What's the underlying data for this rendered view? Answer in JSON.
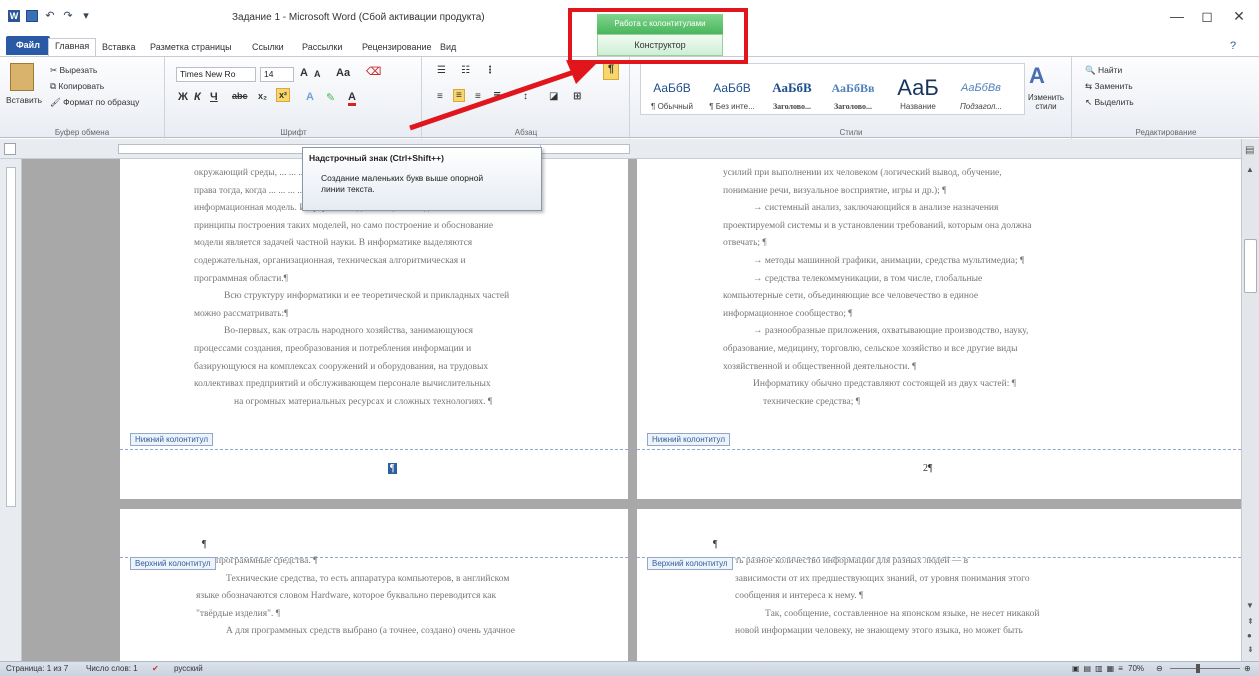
{
  "window": {
    "title": "Задание 1 - Microsoft Word (Сбой активации продукта)",
    "min": "—",
    "max": "◻",
    "close": "✕"
  },
  "tabs": {
    "file": "Файл",
    "items": [
      "Главная",
      "Вставка",
      "Разметка страницы",
      "Ссылки",
      "Рассылки",
      "Рецензирование",
      "Вид"
    ],
    "context_group": "Работа с колонтитулами",
    "context_tab": "Конструктор"
  },
  "ribbon": {
    "clipboard": {
      "paste": "Вставить",
      "cut": "Вырезать",
      "copy": "Копировать",
      "format_painter": "Формат по образцу",
      "label": "Буфер обмена"
    },
    "font": {
      "name": "Times New Ro",
      "size": "14",
      "label": "Шрифт",
      "bold": "Ж",
      "italic": "К",
      "underline": "Ч",
      "grow": "A",
      "shrink": "A",
      "case": "Aa"
    },
    "paragraph": {
      "label": "Абзац",
      "pilcrow": "¶"
    },
    "styles": {
      "label": "Стили",
      "items": [
        {
          "sample": "АаБбВ",
          "name": "¶ Обычный"
        },
        {
          "sample": "АаБбВ",
          "name": "¶ Без инте..."
        },
        {
          "sample": "АаБбВ",
          "name": "Заголово..."
        },
        {
          "sample": "АаБбВв",
          "name": "Заголово..."
        },
        {
          "sample": "АаБ",
          "name": "Название"
        },
        {
          "sample": "АаБбВв",
          "name": "Подзагол..."
        }
      ],
      "change": "Изменить стили"
    },
    "editing": {
      "label": "Редактирование",
      "find": "Найти",
      "replace": "Заменить",
      "select": "Выделить"
    }
  },
  "tooltip": {
    "title": "Надстрочный знак (Ctrl+Shift++)",
    "body": "Создание маленьких букв выше опорной линии текста."
  },
  "pages": {
    "top_left": {
      "lines": [
        "окружающий среды, ... ... ... ... ... ... ... ... ... ... ... ... ... ... ... ... ... ... от в свое",
        "права тогда, когда ... ... ... ... ... ... ... ... ... ... ... ... ... ... ... ... ... ... ... ... ...",
        "информационная модель. Информатика дает общие методологические",
        "принципы построения таких моделей, но само построение и обоснование",
        "модели является задачей частной науки. В информатике выделяются",
        "содержательная, организационная, техническая алгоритмическая и",
        "программная области.¶",
        "Всю структуру информатики и ее теоретической и прикладных частей",
        "можно рассматривать:¶",
        "Во-первых, как отрасль народного хозяйства, занимающуюся",
        "процессами создания, преобразования и потребления информации и",
        "базирующуюся на комплексах сооружений и оборудования, на трудовых",
        "коллективах предприятий и обслуживающем персонале вычислительных",
        "на огромных материальных ресурсах и сложных технологиях. ¶"
      ],
      "footer_tag": "Нижний колонтитул",
      "page_num": "¶"
    },
    "top_right": {
      "lines": [
        "усилий при выполнении их человеком (логический вывод, обучение,",
        "понимание речи, визуальное восприятие, игры и др.); ¶",
        "→ системный анализ, заключающийся в анализе назначения",
        "проектируемой системы и в установлении требований, которым она должна",
        "отвечать; ¶",
        "→ методы машинной графики, анимации, средства мультимедиа; ¶",
        "→ средства телекоммуникации, в том числе, глобальные",
        "компьютерные сети, объединяющие все человечество в единое",
        "информационное сообщество; ¶",
        "→ разнообразные приложения, охватывающие производство, науку,",
        "образование, медицину, торговлю, сельское хозяйство и все другие виды",
        "хозяйственной и общественной деятельности. ¶",
        "Информатику обычно представляют состоящей из двух частей: ¶",
        "технические средства; ¶"
      ],
      "footer_tag": "Нижний колонтитул",
      "page_num": "2¶"
    },
    "bottom_left": {
      "mark": "¶",
      "header_tag": "Верхний колонтитул",
      "lines": [
        "программные средства. ¶",
        "Технические средства, то есть аппаратура компьютеров, в английском",
        "языке обозначаются словом Hardware, которое буквально переводится как",
        "\"твёрдые изделия\". ¶",
        "А для программных средств выбрано (а точнее, создано) очень удачное"
      ]
    },
    "bottom_right": {
      "mark": "¶",
      "header_tag": "Верхний колонтитул",
      "lines": [
        "ть разное количество информации для разных людей — в",
        "зависимости от их предшествующих знаний, от уровня понимания этого",
        "сообщения и интереса к нему. ¶",
        "Так, сообщение, составленное на японском языке, не несет никакой",
        "новой информации человеку, не знающему этого языка, но может быть"
      ]
    }
  },
  "statusbar": {
    "page": "Страница: 1 из 7",
    "words": "Число слов: 1",
    "language": "русский",
    "zoom": "70%"
  }
}
